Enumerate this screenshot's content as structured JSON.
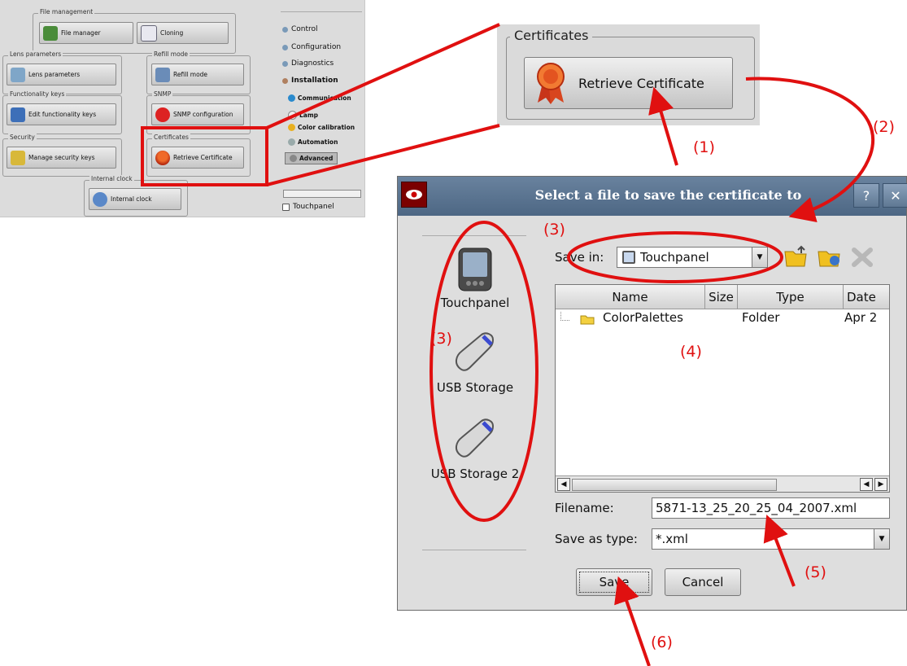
{
  "thumbnail": {
    "groups": {
      "file_management": "File management",
      "lens_parameters": "Lens parameters",
      "refill_mode": "Refill mode",
      "functionality_keys": "Functionality keys",
      "snmp": "SNMP",
      "security": "Security",
      "certificates": "Certificates",
      "internal_clock": "Internal clock"
    },
    "buttons": {
      "file_manager": "File manager",
      "cloning": "Cloning",
      "lens_parameters": "Lens parameters",
      "refill_mode": "Refill mode",
      "edit_functionality_keys": "Edit functionality keys",
      "snmp_configuration": "SNMP configuration",
      "manage_security_keys": "Manage security keys",
      "retrieve_certificate": "Retrieve Certificate",
      "internal_clock": "Internal clock"
    },
    "nav": {
      "control": "Control",
      "configuration": "Configuration",
      "diagnostics": "Diagnostics",
      "installation": "Installation",
      "touchpanel": "Touchpanel"
    },
    "installation_items": {
      "communication": "Communication",
      "lamp": "Lamp",
      "color_calibration": "Color calibration",
      "automation": "Automation",
      "advanced": "Advanced"
    }
  },
  "cert_zoom": {
    "group_title": "Certificates",
    "button_label": "Retrieve Certificate"
  },
  "dialog": {
    "title": "Select a file to save the certificate to",
    "help_glyph": "?",
    "close_glyph": "✕",
    "sidebar": [
      {
        "label": "Touchpanel",
        "icon": "touchpanel-icon"
      },
      {
        "label": "USB Storage",
        "icon": "usb-storage-icon"
      },
      {
        "label": "USB Storage 2",
        "icon": "usb-storage-icon"
      }
    ],
    "save_in_label": "Save in:",
    "save_in_value": "Touchpanel",
    "columns": [
      "Name",
      "Size",
      "Type",
      "Date"
    ],
    "rows": [
      {
        "name": "ColorPalettes",
        "size": "",
        "type": "Folder",
        "date": "Apr 2"
      }
    ],
    "filename_label": "Filename:",
    "filename_value": "5871-13_25_20_25_04_2007.xml",
    "save_as_type_label": "Save as type:",
    "save_as_type_value": "*.xml",
    "save_button": "Save",
    "cancel_button": "Cancel"
  },
  "annotations": {
    "a1": "(1)",
    "a2": "(2)",
    "a3a": "(3)",
    "a3b": "(3)",
    "a4": "(4)",
    "a5": "(5)",
    "a6": "(6)",
    "color": "#e01010"
  }
}
